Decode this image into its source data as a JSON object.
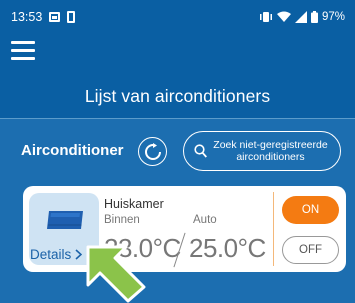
{
  "status_bar": {
    "time": "13:53",
    "battery": "97%",
    "icons": [
      "gallery-icon",
      "sim-icon",
      "vibrate-icon",
      "wifi-icon",
      "signal-icon",
      "battery-icon"
    ]
  },
  "header": {
    "title": "Lijst van airconditioners",
    "menu_icon": "hamburger-menu-icon"
  },
  "section": {
    "label": "Airconditioner",
    "refresh_icon": "refresh-icon",
    "search_button_label": "Zoek niet-geregistreerde airconditioners",
    "search_icon": "search-icon"
  },
  "unit": {
    "room_name": "Huiskamer",
    "indoor_label": "Binnen",
    "mode_label": "Auto",
    "indoor_temp": "23.0°C",
    "set_temp": "25.0°C",
    "details_label": "Details",
    "on_label": "ON",
    "off_label": "OFF",
    "icon": "air-conditioner-icon",
    "power_state": "ON"
  },
  "colors": {
    "background": "#1c6eb0",
    "header": "#0a5fa3",
    "accent_on": "#f47b12",
    "link": "#1b62a8",
    "pointer": "#8bc34a"
  }
}
